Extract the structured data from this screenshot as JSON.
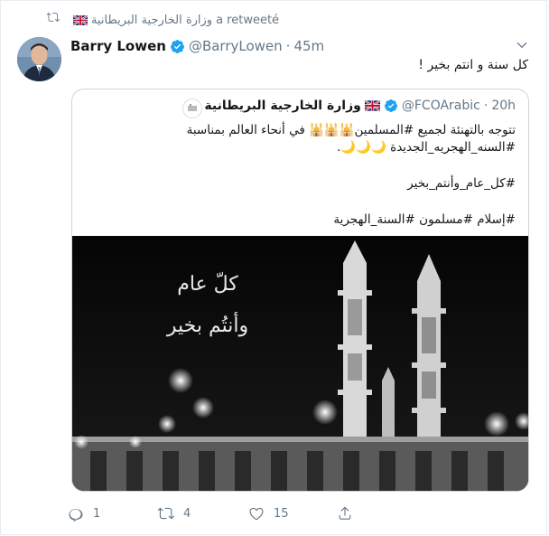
{
  "retweet": {
    "retweeter": "وزارة الخارجية البريطانية",
    "suffix": "a retweeté"
  },
  "author": {
    "name": "Barry Lowen",
    "handle": "@BarryLowen",
    "separator": "·",
    "time": "45m"
  },
  "tweet_text": "كل سنة و انتم بخير !",
  "quote": {
    "name": "وزارة الخارجية البريطانية",
    "handle": "@FCOArabic",
    "separator": "·",
    "time": "20h",
    "line1": "تتوجه بالتهنئة لجميع #المسلمين🕌🕌🕌 في أنحاء العالم بمناسبة",
    "line2": "#السنه_الهجريه_الجديدة 🌙🌙🌙.",
    "line3": "#كل_عام_وأنتم_بخير",
    "line4": "#إسلام #مسلمون #السنة_الهجرية",
    "image_text1": "كلّ عام",
    "image_text2": "وأنتُم بخير"
  },
  "actions": {
    "replies": "1",
    "retweets": "4",
    "likes": "15"
  },
  "colors": {
    "accent": "#1da1f2",
    "muted": "#657786",
    "border": "#e6ecf0"
  }
}
